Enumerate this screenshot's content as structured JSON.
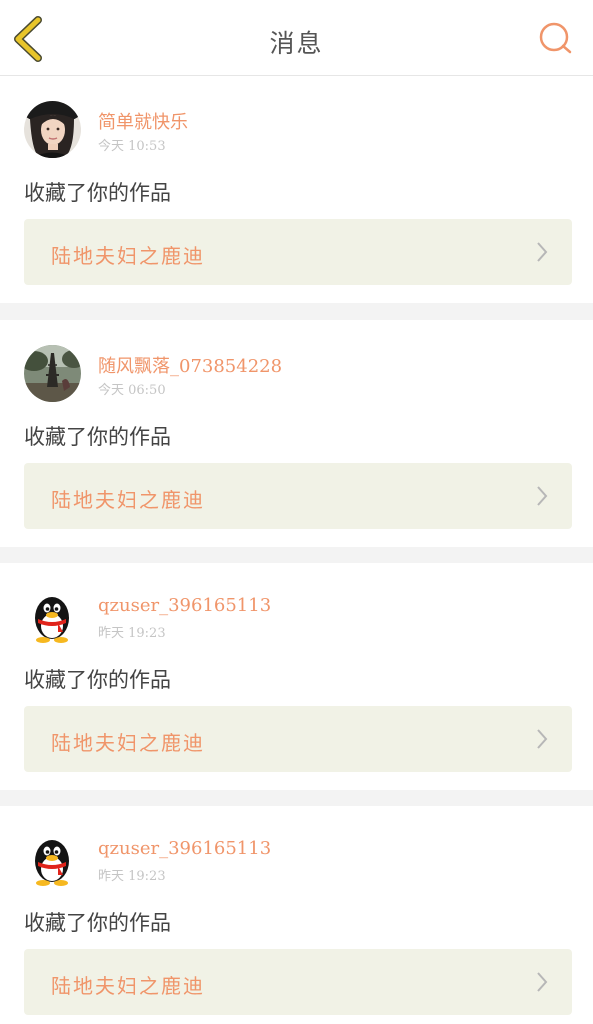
{
  "header": {
    "title": "消息",
    "back_icon": "chevron-left-icon",
    "search_icon": "search-icon",
    "back_color": "#e8c52a",
    "search_color": "#f0956a"
  },
  "colors": {
    "accent": "#f0956a",
    "work_box_bg": "#f1f2e6",
    "separator": "#f3f3f3"
  },
  "messages": [
    {
      "avatar": "avatar-woman-photo",
      "username": "简单就快乐",
      "time": "今天 10:53",
      "action": "收藏了你的作品",
      "work_title": "陆地夫妇之鹿迪"
    },
    {
      "avatar": "avatar-tower-photo",
      "username": "随风飘落_073854228",
      "time": "今天 06:50",
      "action": "收藏了你的作品",
      "work_title": "陆地夫妇之鹿迪"
    },
    {
      "avatar": "qq-penguin-avatar",
      "username": "qzuser_396165113",
      "time": "昨天 19:23",
      "action": "收藏了你的作品",
      "work_title": "陆地夫妇之鹿迪"
    },
    {
      "avatar": "qq-penguin-avatar",
      "username": "qzuser_396165113",
      "time": "昨天 19:23",
      "action": "收藏了你的作品",
      "work_title": "陆地夫妇之鹿迪"
    }
  ]
}
